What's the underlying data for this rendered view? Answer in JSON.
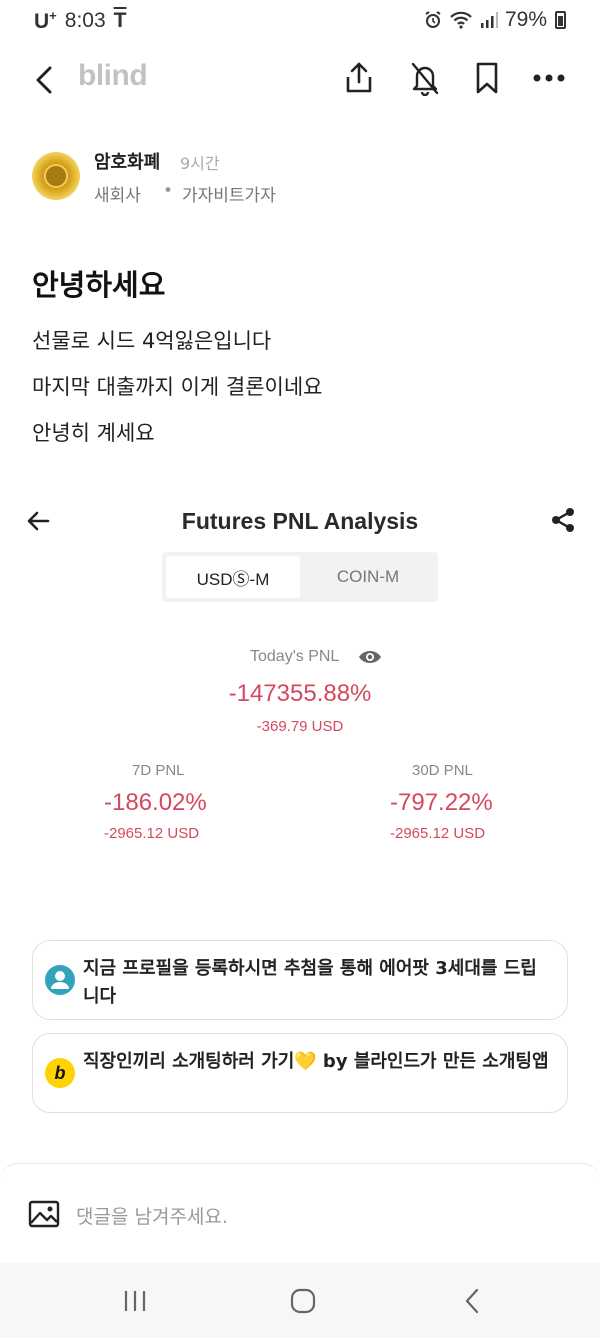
{
  "status": {
    "carrier": "U",
    "carrier_sup": "+",
    "time": "8:03",
    "extra_icon": "T",
    "battery_pct": "79%"
  },
  "header": {
    "brand": "blind",
    "icons": [
      "back-arrow-icon",
      "share-icon",
      "notification-off-icon",
      "bookmark-icon",
      "more-dots-icon"
    ]
  },
  "post": {
    "author_name": "암호화폐",
    "time_ago": "9시간",
    "company": "새회사",
    "separator": "•",
    "job": "가자비트가자",
    "title": "안녕하세요",
    "lines": [
      "선물로 시드 4억잃은입니다",
      "마지막 대출까지 이게 결론이네요",
      "안녕히 계세요"
    ]
  },
  "screenshot": {
    "title": "Futures PNL Analysis",
    "tabs": [
      "USDⓈ-M",
      "COIN-M"
    ],
    "active_tab": "USDⓈ-M",
    "today_label": "Today's PNL",
    "today_pct": "-147355.88%",
    "today_usd": "-369.79 USD",
    "seven_day": {
      "label": "7D PNL",
      "pct": "-186.02%",
      "usd": "-2965.12 USD"
    },
    "thirty_day": {
      "label": "30D PNL",
      "pct": "-797.22%",
      "usd": "-2965.12 USD"
    },
    "accent_negative": "#d4495e"
  },
  "cards": [
    {
      "icon": "profile-icon",
      "text": "지금 프로필을 등록하시면 추첨을 통해 에어팟 3세대를 드립니다"
    },
    {
      "icon": "blind-logo-icon",
      "icon_letter": "b",
      "text": "직장인끼리 소개팅하러 가기💛 by 블라인드가 만든 소개팅앱"
    }
  ],
  "comment": {
    "placeholder": "댓글을 남겨주세요."
  },
  "nav": {
    "icons": [
      "recent-apps-icon",
      "home-icon",
      "back-icon"
    ]
  }
}
